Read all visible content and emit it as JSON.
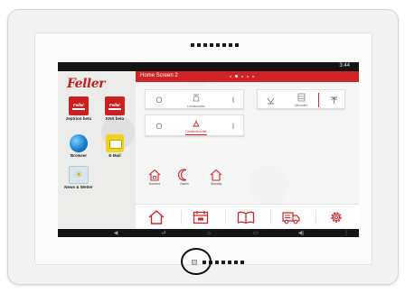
{
  "device": {
    "status_time": "3:44"
  },
  "sidebar": {
    "logo_text": "Feller",
    "apps": [
      {
        "label": "zeptrion beta",
        "icon": "feller-app-icon"
      },
      {
        "label": "KNX beta",
        "icon": "feller-app-icon"
      },
      {
        "label": "Browser",
        "icon": "globe-icon"
      },
      {
        "label": "E-Mail",
        "icon": "mail-icon"
      },
      {
        "label": "News & Wetter",
        "icon": "weather-icon"
      }
    ],
    "icon_text": {
      "feller": "Feller",
      "weather": "☀"
    }
  },
  "panel": {
    "title": "Home Screen 2",
    "page_count": 5,
    "active_page": 2,
    "cards": {
      "light": {
        "label": "Lichtschalter"
      },
      "dimmer": {
        "label": "Deckenleuchte"
      },
      "blind": {
        "label": "Jalousien"
      }
    },
    "glyphs": {
      "off": "O",
      "on": "I"
    },
    "scenes": [
      {
        "label": "Komfort",
        "icon": "home-icon"
      },
      {
        "label": "Nacht",
        "icon": "moon-icon"
      },
      {
        "label": "Standby",
        "icon": "home-outline-icon"
      }
    ]
  },
  "dock": {
    "items": [
      {
        "name": "home",
        "icon": "home-icon"
      },
      {
        "name": "calendar",
        "icon": "calendar-icon"
      },
      {
        "name": "book",
        "icon": "book-icon"
      },
      {
        "name": "truck",
        "icon": "truck-icon"
      },
      {
        "name": "settings",
        "icon": "gear-icon"
      }
    ]
  },
  "navbar": {
    "glyphs": {
      "volume_down": "◀",
      "back": "⮐",
      "home": "⌂",
      "recent": "▭",
      "volume_up": "◀)",
      "menu": "⋮"
    }
  },
  "colors": {
    "accent": "#d22427",
    "statusbar": "#141414",
    "bezel": "#f3f3f3"
  }
}
